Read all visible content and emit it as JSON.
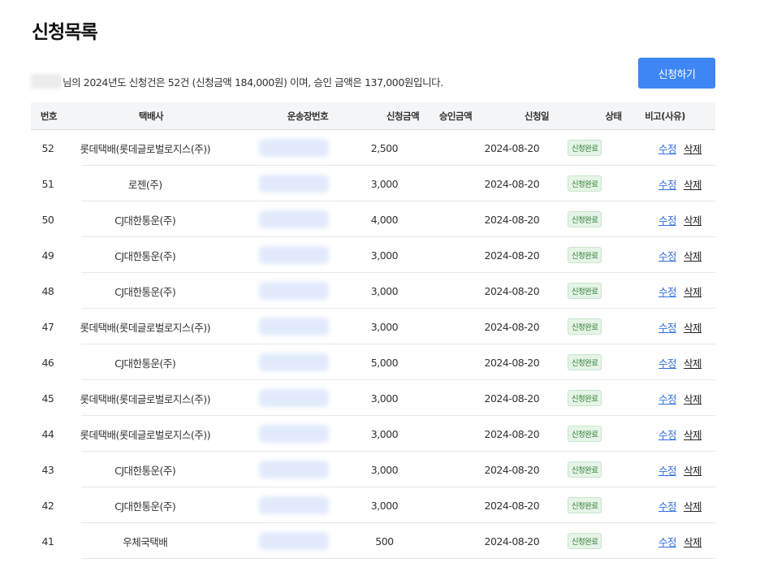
{
  "page": {
    "title": "신청목록"
  },
  "summary": {
    "text": "님의 2024년도 신청건은 52건 (신청금액 184,000원) 이며, 승인 금액은 137,000원입니다."
  },
  "toolbar": {
    "apply_label": "신청하기"
  },
  "table": {
    "headers": {
      "no": "번호",
      "courier": "택배사",
      "tracking": "운송장번호",
      "request_amount": "신청금액",
      "approved_amount": "승인금액",
      "date": "신청일",
      "status": "상태",
      "note": "비고(사유)"
    },
    "actions": {
      "edit": "수정",
      "delete": "삭제"
    },
    "rows": [
      {
        "no": "52",
        "courier": "롯데택배(롯데글로벌로지스(주))",
        "amount": "2,500",
        "approved": "",
        "date": "2024-08-20",
        "status": "신청완료",
        "note": ""
      },
      {
        "no": "51",
        "courier": "로젠(주)",
        "amount": "3,000",
        "approved": "",
        "date": "2024-08-20",
        "status": "신청완료",
        "note": ""
      },
      {
        "no": "50",
        "courier": "CJ대한통운(주)",
        "amount": "4,000",
        "approved": "",
        "date": "2024-08-20",
        "status": "신청완료",
        "note": ""
      },
      {
        "no": "49",
        "courier": "CJ대한통운(주)",
        "amount": "3,000",
        "approved": "",
        "date": "2024-08-20",
        "status": "신청완료",
        "note": ""
      },
      {
        "no": "48",
        "courier": "CJ대한통운(주)",
        "amount": "3,000",
        "approved": "",
        "date": "2024-08-20",
        "status": "신청완료",
        "note": ""
      },
      {
        "no": "47",
        "courier": "롯데택배(롯데글로벌로지스(주))",
        "amount": "3,000",
        "approved": "",
        "date": "2024-08-20",
        "status": "신청완료",
        "note": ""
      },
      {
        "no": "46",
        "courier": "CJ대한통운(주)",
        "amount": "5,000",
        "approved": "",
        "date": "2024-08-20",
        "status": "신청완료",
        "note": ""
      },
      {
        "no": "45",
        "courier": "롯데택배(롯데글로벌로지스(주))",
        "amount": "3,000",
        "approved": "",
        "date": "2024-08-20",
        "status": "신청완료",
        "note": ""
      },
      {
        "no": "44",
        "courier": "롯데택배(롯데글로벌로지스(주))",
        "amount": "3,000",
        "approved": "",
        "date": "2024-08-20",
        "status": "신청완료",
        "note": ""
      },
      {
        "no": "43",
        "courier": "CJ대한통운(주)",
        "amount": "3,000",
        "approved": "",
        "date": "2024-08-20",
        "status": "신청완료",
        "note": ""
      },
      {
        "no": "42",
        "courier": "CJ대한통운(주)",
        "amount": "3,000",
        "approved": "",
        "date": "2024-08-20",
        "status": "신청완료",
        "note": ""
      },
      {
        "no": "41",
        "courier": "우체국택배",
        "amount": "500",
        "approved": "",
        "date": "2024-08-20",
        "status": "신청완료",
        "note": ""
      }
    ]
  },
  "colors": {
    "primary": "#3d86f4",
    "header_bg": "#f4f5f7",
    "status_badge_bg": "#e6f4e7",
    "status_badge_text": "#2e7d32",
    "edit_link": "#2f6fe0"
  }
}
